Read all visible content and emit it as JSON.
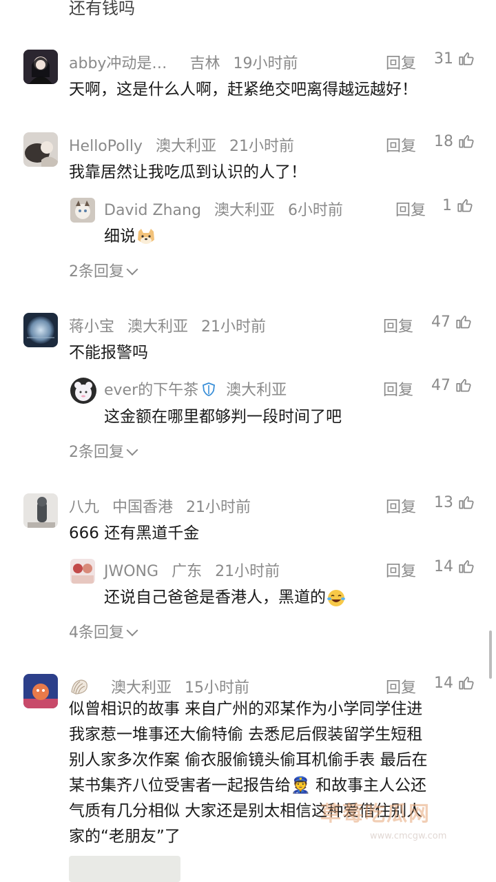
{
  "top_partial_text": "还有钱吗",
  "comments": [
    {
      "user": "abby冲动是…",
      "location": "吉林",
      "time": "19小时前",
      "reply_label": "回复",
      "likes": "31",
      "text": "天啊，这是什么人啊，赶紧绝交吧离得越远越好！"
    },
    {
      "user": "HelloPolly",
      "location": "澳大利亚",
      "time": "21小时前",
      "reply_label": "回复",
      "likes": "18",
      "text": "我靠居然让我吃瓜到认识的人了！",
      "reply": {
        "user": "David Zhang",
        "location": "澳大利亚",
        "time": "6小时前",
        "reply_label": "回复",
        "likes": "1",
        "text": "细说"
      },
      "more_replies": "2条回复"
    },
    {
      "user": "蒋小宝",
      "location": "澳大利亚",
      "time": "21小时前",
      "reply_label": "回复",
      "likes": "47",
      "text": "不能报警吗",
      "reply": {
        "user": "ever的下午茶",
        "location": "澳大利亚",
        "time": "",
        "reply_label": "回复",
        "likes": "47",
        "text": "这金额在哪里都够判一段时间了吧"
      },
      "more_replies": "2条回复"
    },
    {
      "user": "八九",
      "location": "中国香港",
      "time": "21小时前",
      "reply_label": "回复",
      "likes": "13",
      "text": "666 还有黑道千金",
      "reply": {
        "user": "JWONG",
        "location": "广东",
        "time": "21小时前",
        "reply_label": "回复",
        "likes": "14",
        "text": "还说自己爸爸是香港人，黑道的"
      },
      "more_replies": "4条回复"
    },
    {
      "user": "",
      "location": "澳大利亚",
      "time": "15小时前",
      "reply_label": "回复",
      "likes": "14",
      "lines": [
        "似曾相识的故事 来自广州的邓某作为小学同学住进",
        "我家惹一堆事还大偷特偷 去悉尼后假装留学生短租",
        "别人家多次作案 偷衣服偷镜头偷耳机偷手表 最后在",
        "某书集齐八位受害者一起报告给👮 和故事主人公还",
        "气质有几分相似 大家还是别太相信这种爱借住别人",
        "家的“老朋友”了"
      ]
    }
  ],
  "watermark": {
    "cn": "草莓吃瓜网",
    "url": "www.cmcgw.com"
  },
  "colors": {
    "meta_gray": "#8a8a8a",
    "text": "#1a1a1a",
    "background": "#ffffff"
  }
}
